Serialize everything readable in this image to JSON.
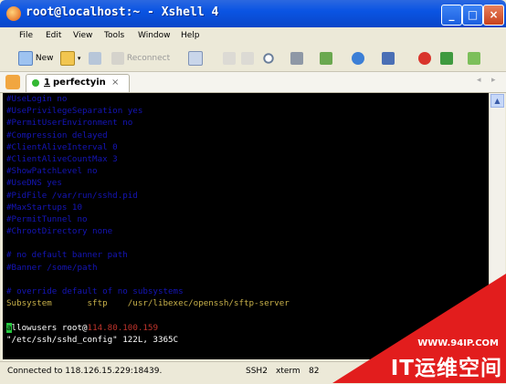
{
  "window": {
    "title": "root@localhost:~ - Xshell 4",
    "minimize": "_",
    "maximize": "□",
    "close": "×"
  },
  "menu": [
    "File",
    "Edit",
    "View",
    "Tools",
    "Window",
    "Help"
  ],
  "toolbar": {
    "new_label": "New",
    "reconnect_label": "Reconnect"
  },
  "tab": {
    "number": "1",
    "name": "perfectyin",
    "close": "×"
  },
  "terminal": {
    "lines": [
      {
        "text": "#UseLogin no",
        "style": "comment"
      },
      {
        "text": "#UsePrivilegeSeparation yes",
        "style": "comment"
      },
      {
        "text": "#PermitUserEnvironment no",
        "style": "comment"
      },
      {
        "text": "#Compression delayed",
        "style": "comment"
      },
      {
        "text": "#ClientAliveInterval 0",
        "style": "comment"
      },
      {
        "text": "#ClientAliveCountMax 3",
        "style": "comment"
      },
      {
        "text": "#ShowPatchLevel no",
        "style": "comment"
      },
      {
        "text": "#UseDNS yes",
        "style": "comment"
      },
      {
        "text": "#PidFile /var/run/sshd.pid",
        "style": "comment"
      },
      {
        "text": "#MaxStartups 10",
        "style": "comment"
      },
      {
        "text": "#PermitTunnel no",
        "style": "comment"
      },
      {
        "text": "#ChrootDirectory none",
        "style": "comment"
      },
      {
        "text": "",
        "style": "comment"
      },
      {
        "text": "# no default banner path",
        "style": "comment"
      },
      {
        "text": "#Banner /some/path",
        "style": "comment"
      },
      {
        "text": "",
        "style": "comment"
      },
      {
        "text": "# override default of no subsystems",
        "style": "comment"
      },
      {
        "text": "Subsystem       sftp    /usr/libexec/openssh/sftp-server",
        "style": "yellow"
      },
      {
        "text": "",
        "style": "comment"
      }
    ],
    "allow_cursor": "a",
    "allow_rest": "llowusers root@",
    "allow_ip": "114.80.100.159",
    "file_info": "\"/etc/ssh/sshd_config\" 122L, 3365C"
  },
  "status": {
    "connection": "Connected to 118.126.15.229:18439.",
    "protocol": "SSH2",
    "terminal_type": "xterm",
    "size": "82"
  },
  "watermark": {
    "url": "WWW.94IP.COM",
    "brand": "IT运维空间"
  }
}
